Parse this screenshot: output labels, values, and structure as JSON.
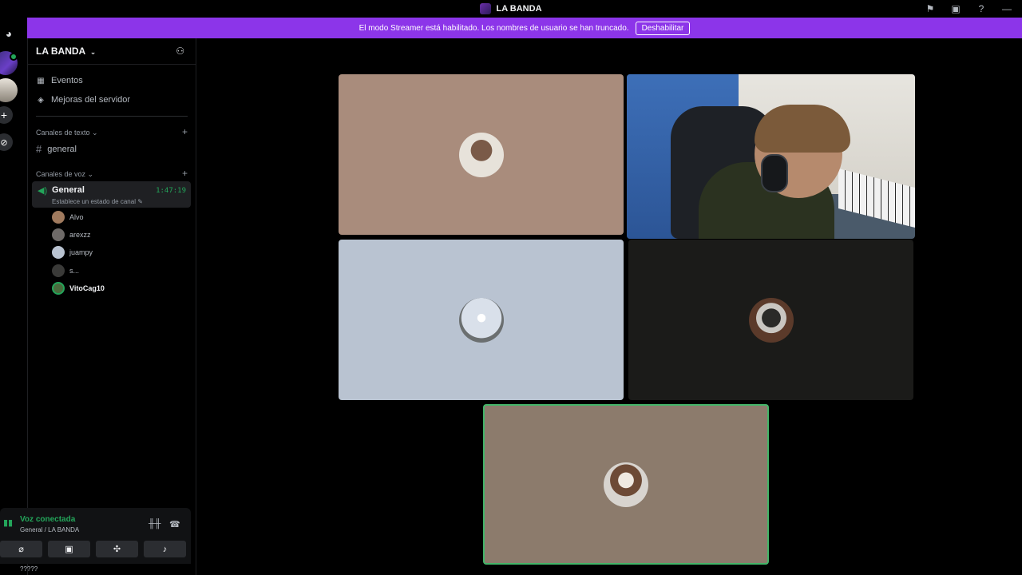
{
  "window": {
    "title": "LA BANDA"
  },
  "banner": {
    "text": "El modo Streamer está habilitado. Los nombres de usuario se han truncado.",
    "button": "Deshabilitar"
  },
  "server": {
    "name": "LA BANDA",
    "nav": [
      {
        "label": "Eventos",
        "icon": "calendar-icon"
      },
      {
        "label": "Mejoras del servidor",
        "icon": "boost-icon"
      }
    ],
    "text_category": "Canales de texto",
    "text_channels": [
      {
        "label": "general"
      }
    ],
    "voice_category": "Canales de voz",
    "voice_channel": {
      "name": "General",
      "timer": "1:47:19",
      "status": "Establece un estado de canal"
    },
    "members": [
      {
        "name": "Alvo",
        "color": "#a07a5e"
      },
      {
        "name": "arexzz",
        "color": "#6e6a68"
      },
      {
        "name": "juampy",
        "color": "#b9c3d1"
      },
      {
        "name": "s...",
        "color": "#3a3a38"
      },
      {
        "name": "VitoCag10",
        "color": "#4a6b3e"
      }
    ]
  },
  "voice_panel": {
    "status": "Voz conectada",
    "location": "General / LA BANDA",
    "buttons": [
      {
        "icon": "camera-off-icon",
        "glyph": "⌀"
      },
      {
        "icon": "screen-share-icon",
        "glyph": "▣"
      },
      {
        "icon": "activities-icon",
        "glyph": "✣"
      },
      {
        "icon": "soundboard-icon",
        "glyph": "♪"
      }
    ]
  },
  "user_strip": {
    "text": "?????"
  },
  "colors": {
    "accent": "#8c35e9",
    "voice_green": "#23a55a",
    "speaking_border": "#43b569"
  }
}
